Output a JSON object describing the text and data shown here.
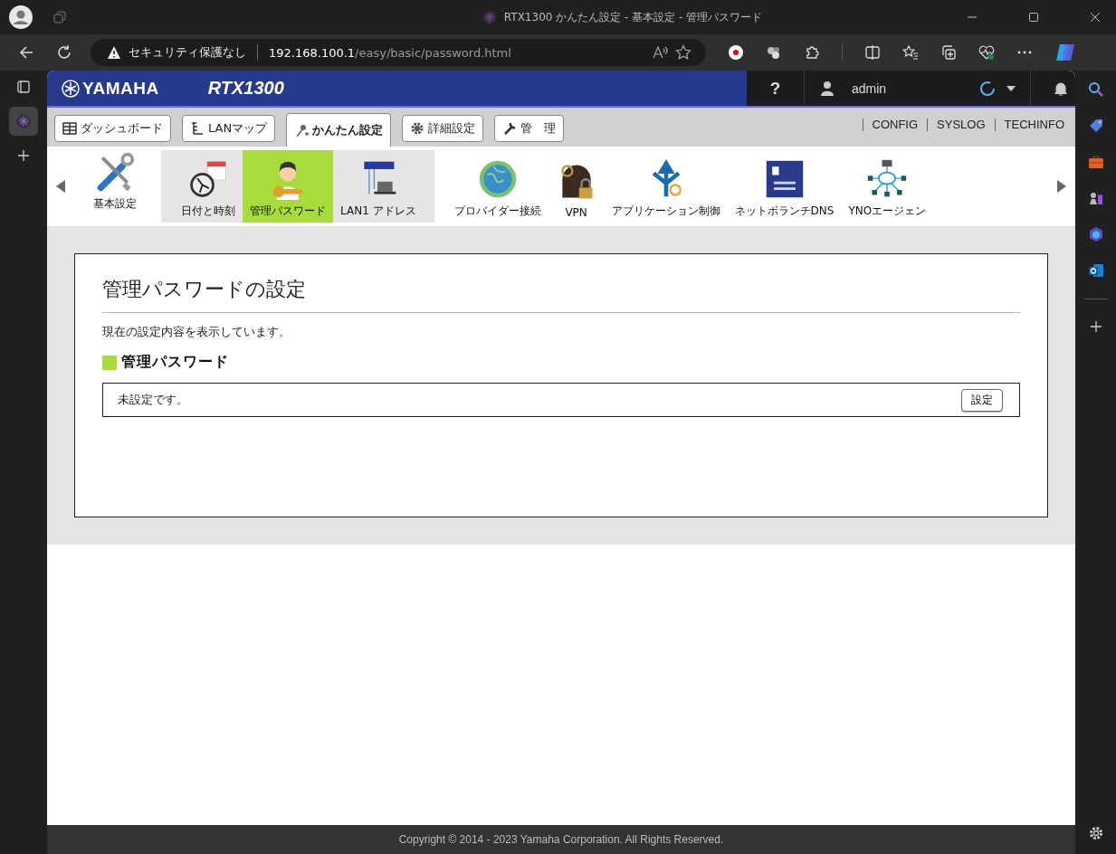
{
  "browser": {
    "title": "RTX1300 かんたん設定 - 基本設定 - 管理パスワード",
    "security_label": "セキュリティ保護なし",
    "url_host": "192.168.100.1",
    "url_path": "/easy/basic/password.html"
  },
  "header": {
    "brand": "YAMAHA",
    "model": "RTX1300",
    "help": "?",
    "user": "admin"
  },
  "tabs": [
    {
      "label": "ダッシュボード",
      "selected": false
    },
    {
      "label": "LANマップ",
      "selected": false
    },
    {
      "label": "かんたん設定",
      "selected": true
    },
    {
      "label": "詳細設定",
      "selected": false
    },
    {
      "label": "管　理",
      "selected": false
    }
  ],
  "links": [
    "CONFIG",
    "SYSLOG",
    "TECHINFO"
  ],
  "menu": [
    {
      "label": "基本設定",
      "kind": "main",
      "selected": false
    },
    {
      "label": "日付と時刻",
      "kind": "sub",
      "selected": false
    },
    {
      "label": "管理パスワード",
      "kind": "sub",
      "selected": true
    },
    {
      "label": "LAN1 アドレス",
      "kind": "sub",
      "selected": false
    },
    {
      "label": "プロバイダー接続",
      "kind": "main",
      "selected": false
    },
    {
      "label": "VPN",
      "kind": "main",
      "selected": false
    },
    {
      "label": "アプリケーション制御",
      "kind": "main",
      "selected": false
    },
    {
      "label": "ネットボランチDNS",
      "kind": "main",
      "selected": false
    },
    {
      "label": "YNOエージェン",
      "kind": "main",
      "selected": false
    }
  ],
  "panel": {
    "title": "管理パスワードの設定",
    "description": "現在の設定内容を表示しています。",
    "section_title": "管理パスワード",
    "status": "未設定です。",
    "button": "設定"
  },
  "footer": "Copyright © 2014 - 2023 Yamaha Corporation. All Rights Reserved."
}
